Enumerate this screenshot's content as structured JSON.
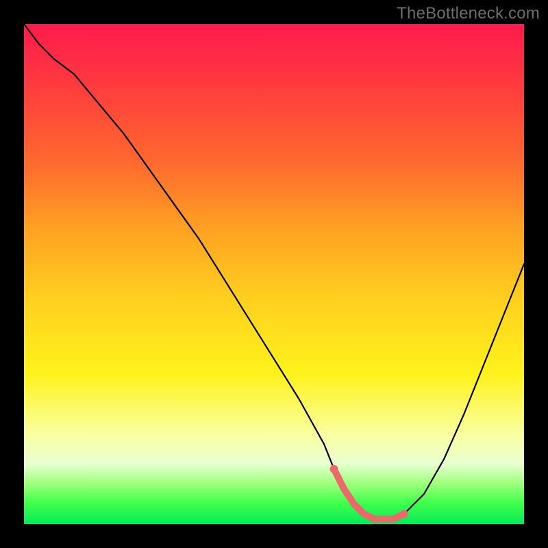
{
  "watermark": "TheBottleneck.com",
  "gradient_colors": {
    "top": "#ff1a4d",
    "mid1": "#ff6a2e",
    "mid2": "#ffd21f",
    "mid3": "#fff21c",
    "bottom": "#08e85a"
  },
  "curve_stroke": "#000000",
  "highlight_stroke": "#e86a6a",
  "chart_data": {
    "type": "line",
    "title": "",
    "xlabel": "",
    "ylabel": "",
    "xlim": [
      0,
      100
    ],
    "ylim": [
      0,
      100
    ],
    "grid": false,
    "legend": false,
    "series": [
      {
        "name": "bottleneck-curve",
        "x": [
          0,
          3,
          6,
          10,
          15,
          20,
          25,
          30,
          35,
          40,
          45,
          50,
          55,
          60,
          62,
          64,
          66,
          68,
          70,
          72,
          74,
          76,
          80,
          84,
          88,
          92,
          96,
          100
        ],
        "y": [
          100,
          96,
          93,
          90,
          84,
          78,
          71,
          64,
          57,
          49,
          41,
          33,
          25,
          16,
          11,
          7,
          4,
          2,
          1,
          1,
          1,
          2,
          6,
          13,
          22,
          32,
          42,
          52
        ]
      },
      {
        "name": "sweet-spot-highlight",
        "x": [
          62,
          64,
          66,
          68,
          70,
          72,
          74,
          76
        ],
        "y": [
          11,
          7,
          4,
          2,
          1,
          1,
          1,
          2
        ]
      }
    ],
    "annotations": [
      {
        "text": "TheBottleneck.com",
        "role": "watermark",
        "position": "top-right"
      }
    ]
  }
}
